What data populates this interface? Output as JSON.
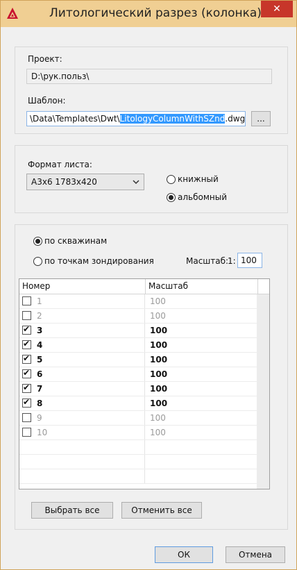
{
  "title": "Литологический разрез (колонка)",
  "close": "✕",
  "project": {
    "label": "Проект:",
    "value": "D:\\рук.польз\\"
  },
  "template": {
    "label": "Шаблон:",
    "prefix": "\\Data\\Templates\\Dwt\\",
    "selected": "LitologyColumnWithSZnd",
    "suffix": ".dwg",
    "browse": "..."
  },
  "sheet": {
    "label": "Формат листа:",
    "value": "А3х6 1783х420",
    "orient_portrait": "книжный",
    "orient_landscape": "альбомный",
    "selected_orientation": "landscape"
  },
  "mode": {
    "by_wells": "по скважинам",
    "by_points": "по точкам зондирования",
    "selected": "by_wells",
    "scale_label": "Масштаб:",
    "scale_prefix": "1:",
    "scale_value": "100"
  },
  "table": {
    "col_number": "Номер",
    "col_scale": "Масштаб",
    "rows": [
      {
        "num": "1",
        "scale": "100",
        "checked": false
      },
      {
        "num": "2",
        "scale": "100",
        "checked": false
      },
      {
        "num": "3",
        "scale": "100",
        "checked": true
      },
      {
        "num": "4",
        "scale": "100",
        "checked": true
      },
      {
        "num": "5",
        "scale": "100",
        "checked": true
      },
      {
        "num": "6",
        "scale": "100",
        "checked": true
      },
      {
        "num": "7",
        "scale": "100",
        "checked": true
      },
      {
        "num": "8",
        "scale": "100",
        "checked": true
      },
      {
        "num": "9",
        "scale": "100",
        "checked": false
      },
      {
        "num": "10",
        "scale": "100",
        "checked": false
      }
    ]
  },
  "buttons": {
    "select_all": "Выбрать все",
    "deselect_all": "Отменить все",
    "ok": "ОК",
    "cancel": "Отмена"
  },
  "colors": {
    "titlebar": "#f0cf93",
    "close": "#c7362a",
    "selection": "#3399ff"
  },
  "icons": {
    "app": "autocad-logo-icon",
    "combo": "chevron-down-icon"
  }
}
